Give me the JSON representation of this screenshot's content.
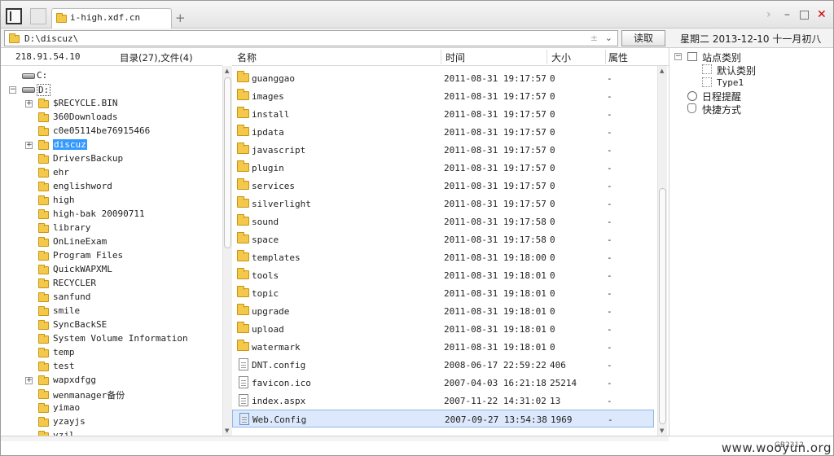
{
  "tab": {
    "title": "i-high.xdf.cn"
  },
  "address": {
    "path": "D:\\discuz\\",
    "read_button": "读取"
  },
  "datebar": "星期二 2013-12-10 十一月初八",
  "left": {
    "server_ip": "218.91.54.10",
    "counts": "目录(27),文件(4)",
    "tree": [
      {
        "label": "C:",
        "type": "drive",
        "indent": 0
      },
      {
        "label": "D:",
        "type": "drive",
        "indent": 0
      },
      {
        "label": "$RECYCLE.BIN",
        "type": "folder",
        "expandable": true
      },
      {
        "label": "360Downloads",
        "type": "folder"
      },
      {
        "label": "c0e05114be76915466",
        "type": "folder"
      },
      {
        "label": "discuz",
        "type": "folder",
        "expandable": true,
        "selected": true
      },
      {
        "label": "DriversBackup",
        "type": "folder"
      },
      {
        "label": "ehr",
        "type": "folder"
      },
      {
        "label": "englishword",
        "type": "folder"
      },
      {
        "label": "high",
        "type": "folder"
      },
      {
        "label": "high-bak 20090711",
        "type": "folder"
      },
      {
        "label": "library",
        "type": "folder"
      },
      {
        "label": "OnLineExam",
        "type": "folder"
      },
      {
        "label": "Program Files",
        "type": "folder"
      },
      {
        "label": "QuickWAPXML",
        "type": "folder"
      },
      {
        "label": "RECYCLER",
        "type": "folder"
      },
      {
        "label": "sanfund",
        "type": "folder"
      },
      {
        "label": "smile",
        "type": "folder"
      },
      {
        "label": "SyncBackSE",
        "type": "folder"
      },
      {
        "label": "System Volume Information",
        "type": "folder"
      },
      {
        "label": "temp",
        "type": "folder"
      },
      {
        "label": "test",
        "type": "folder"
      },
      {
        "label": "wapxdfgg",
        "type": "folder",
        "expandable": true
      },
      {
        "label": "wenmanager备份",
        "type": "folder"
      },
      {
        "label": "yimao",
        "type": "folder"
      },
      {
        "label": "yzayjs",
        "type": "folder"
      },
      {
        "label": "yzjl",
        "type": "folder"
      }
    ]
  },
  "list": {
    "columns": {
      "name": "名称",
      "time": "时间",
      "size": "大小",
      "attr": "属性"
    },
    "rows": [
      {
        "name": "guanggao",
        "time": "2011-08-31 19:17:57",
        "size": "0",
        "attr": "-",
        "type": "folder"
      },
      {
        "name": "images",
        "time": "2011-08-31 19:17:57",
        "size": "0",
        "attr": "-",
        "type": "folder"
      },
      {
        "name": "install",
        "time": "2011-08-31 19:17:57",
        "size": "0",
        "attr": "-",
        "type": "folder"
      },
      {
        "name": "ipdata",
        "time": "2011-08-31 19:17:57",
        "size": "0",
        "attr": "-",
        "type": "folder"
      },
      {
        "name": "javascript",
        "time": "2011-08-31 19:17:57",
        "size": "0",
        "attr": "-",
        "type": "folder"
      },
      {
        "name": "plugin",
        "time": "2011-08-31 19:17:57",
        "size": "0",
        "attr": "-",
        "type": "folder"
      },
      {
        "name": "services",
        "time": "2011-08-31 19:17:57",
        "size": "0",
        "attr": "-",
        "type": "folder"
      },
      {
        "name": "silverlight",
        "time": "2011-08-31 19:17:57",
        "size": "0",
        "attr": "-",
        "type": "folder"
      },
      {
        "name": "sound",
        "time": "2011-08-31 19:17:58",
        "size": "0",
        "attr": "-",
        "type": "folder"
      },
      {
        "name": "space",
        "time": "2011-08-31 19:17:58",
        "size": "0",
        "attr": "-",
        "type": "folder"
      },
      {
        "name": "templates",
        "time": "2011-08-31 19:18:00",
        "size": "0",
        "attr": "-",
        "type": "folder"
      },
      {
        "name": "tools",
        "time": "2011-08-31 19:18:01",
        "size": "0",
        "attr": "-",
        "type": "folder"
      },
      {
        "name": "topic",
        "time": "2011-08-31 19:18:01",
        "size": "0",
        "attr": "-",
        "type": "folder"
      },
      {
        "name": "upgrade",
        "time": "2011-08-31 19:18:01",
        "size": "0",
        "attr": "-",
        "type": "folder"
      },
      {
        "name": "upload",
        "time": "2011-08-31 19:18:01",
        "size": "0",
        "attr": "-",
        "type": "folder"
      },
      {
        "name": "watermark",
        "time": "2011-08-31 19:18:01",
        "size": "0",
        "attr": "-",
        "type": "folder"
      },
      {
        "name": "DNT.config",
        "time": "2008-06-17 22:59:22",
        "size": "406",
        "attr": "-",
        "type": "file"
      },
      {
        "name": "favicon.ico",
        "time": "2007-04-03 16:21:18",
        "size": "25214",
        "attr": "-",
        "type": "file"
      },
      {
        "name": "index.aspx",
        "time": "2007-11-22 14:31:02",
        "size": "13",
        "attr": "-",
        "type": "file"
      },
      {
        "name": "Web.Config",
        "time": "2007-09-27 13:54:38",
        "size": "1969",
        "attr": "-",
        "type": "config",
        "selected": true
      }
    ]
  },
  "right": {
    "site_category": "站点类别",
    "default_category": "默认类别",
    "type1": "Type1",
    "schedule": "日程提醒",
    "shortcuts": "快捷方式"
  },
  "footer": {
    "encoding": "GB2312",
    "watermark": "www.wooyun.org"
  }
}
